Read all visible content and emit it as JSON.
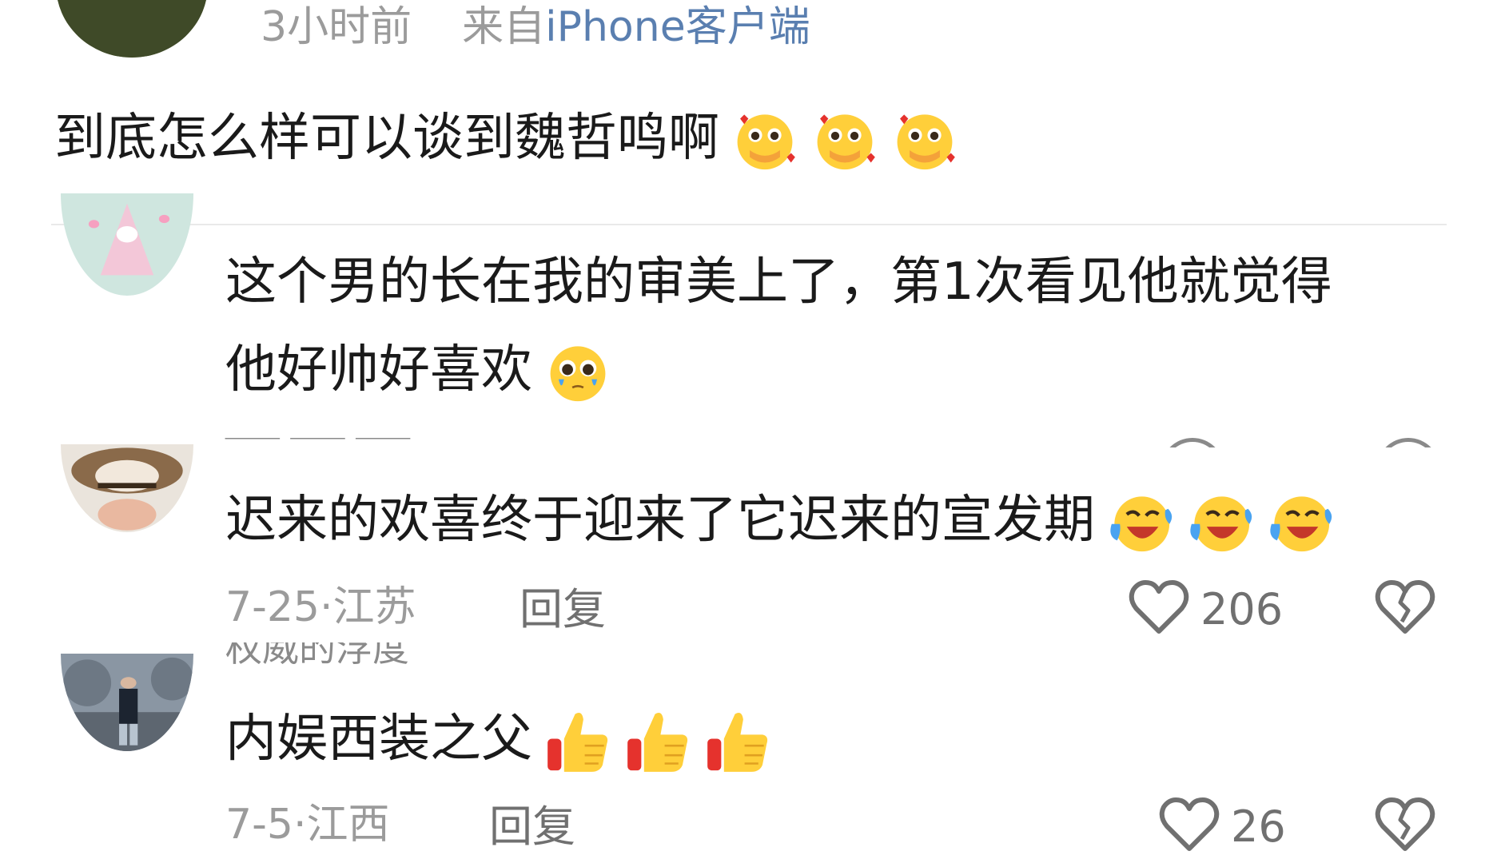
{
  "comments": [
    {
      "time": "3小时前",
      "source_prefix": "来自",
      "source": "iPhone客户端",
      "text": "到底怎么样可以谈到魏哲鸣啊",
      "emojis": [
        "adoring-face-emoji",
        "adoring-face-emoji",
        "adoring-face-emoji"
      ]
    },
    {
      "text_line1": "这个男的长在我的审美上了，第1次看见他就觉得",
      "text_line2": "他好帅好喜欢",
      "emojis": [
        "pleading-face-emoji"
      ]
    },
    {
      "text": "迟来的欢喜终于迎来了它迟来的宣发期",
      "emojis": [
        "laughing-crying-emoji",
        "laughing-crying-emoji",
        "laughing-crying-emoji"
      ],
      "date": "7-25",
      "location": "江苏",
      "reply_label": "回复",
      "likes": "206"
    },
    {
      "username_partial": "权威的浮度",
      "text": "内娱西装之父",
      "emojis": [
        "thumbs-up-emoji",
        "thumbs-up-emoji",
        "thumbs-up-emoji"
      ],
      "date": "7-5",
      "location": "江西",
      "reply_label": "回复",
      "likes": "26"
    }
  ],
  "separator": "·",
  "icons": {
    "like": "heart-outline-icon",
    "dislike": "broken-heart-icon"
  },
  "colors": {
    "meta": "#9b9b9b",
    "source_link": "#5a7fb0",
    "text": "#1a1a1a",
    "emoji_yellow": "#ffcf3a",
    "thumb_red": "#e5322d"
  }
}
